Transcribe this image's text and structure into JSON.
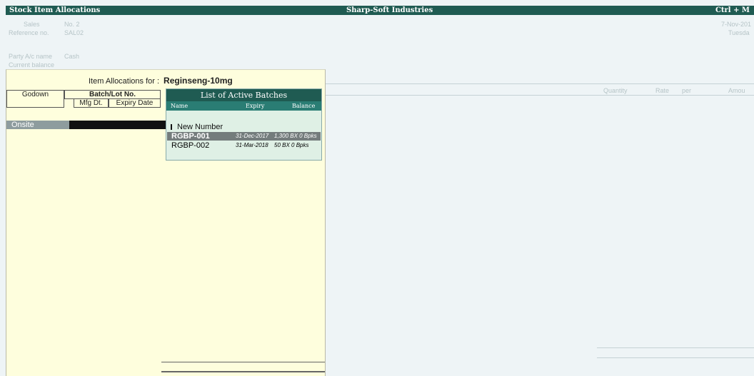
{
  "titlebar": {
    "left": "Stock Item Allocations",
    "center": "Sharp-Soft Industries",
    "right": "Ctrl + M"
  },
  "background": {
    "voucher_type": "Sales",
    "voucher_no": "No. 2",
    "reference_label": "Reference no.",
    "reference_value": "SAL02",
    "date": "7-Nov-201",
    "day": "Tuesda",
    "party_label": "Party A/c name",
    "party_value": "Cash",
    "current_balance_label": "Current balance",
    "col_quantity": "Quantity",
    "col_rate": "Rate",
    "col_per": "per",
    "col_amount": "Amou"
  },
  "allocation": {
    "title_label": "Item Allocations for :",
    "item_name": "Reginseng-10mg",
    "headers": {
      "godown": "Godown",
      "batch": "Batch/Lot No.",
      "mfg": "Mfg Dt.",
      "expiry": "Expiry Date"
    },
    "godown_value": "Onsite"
  },
  "batch_list": {
    "title": "List of Active Batches",
    "columns": {
      "name": "Name",
      "expiry": "Expiry",
      "balance": "Balance"
    },
    "new_number": "New Number",
    "rows": [
      {
        "name": "RGBP-001",
        "expiry": "31-Dec-2017",
        "balance": "1,300 BX 0 Bpks",
        "selected": true
      },
      {
        "name": "RGBP-002",
        "expiry": "31-Mar-2018",
        "balance": "50 BX 0 Bpks",
        "selected": false
      }
    ]
  },
  "colors": {
    "titlebar": "#1f5b52",
    "panel": "#fefedd",
    "batch_header": "#2a7d74",
    "selected_row": "#747c7c",
    "background": "#eef4f6"
  }
}
